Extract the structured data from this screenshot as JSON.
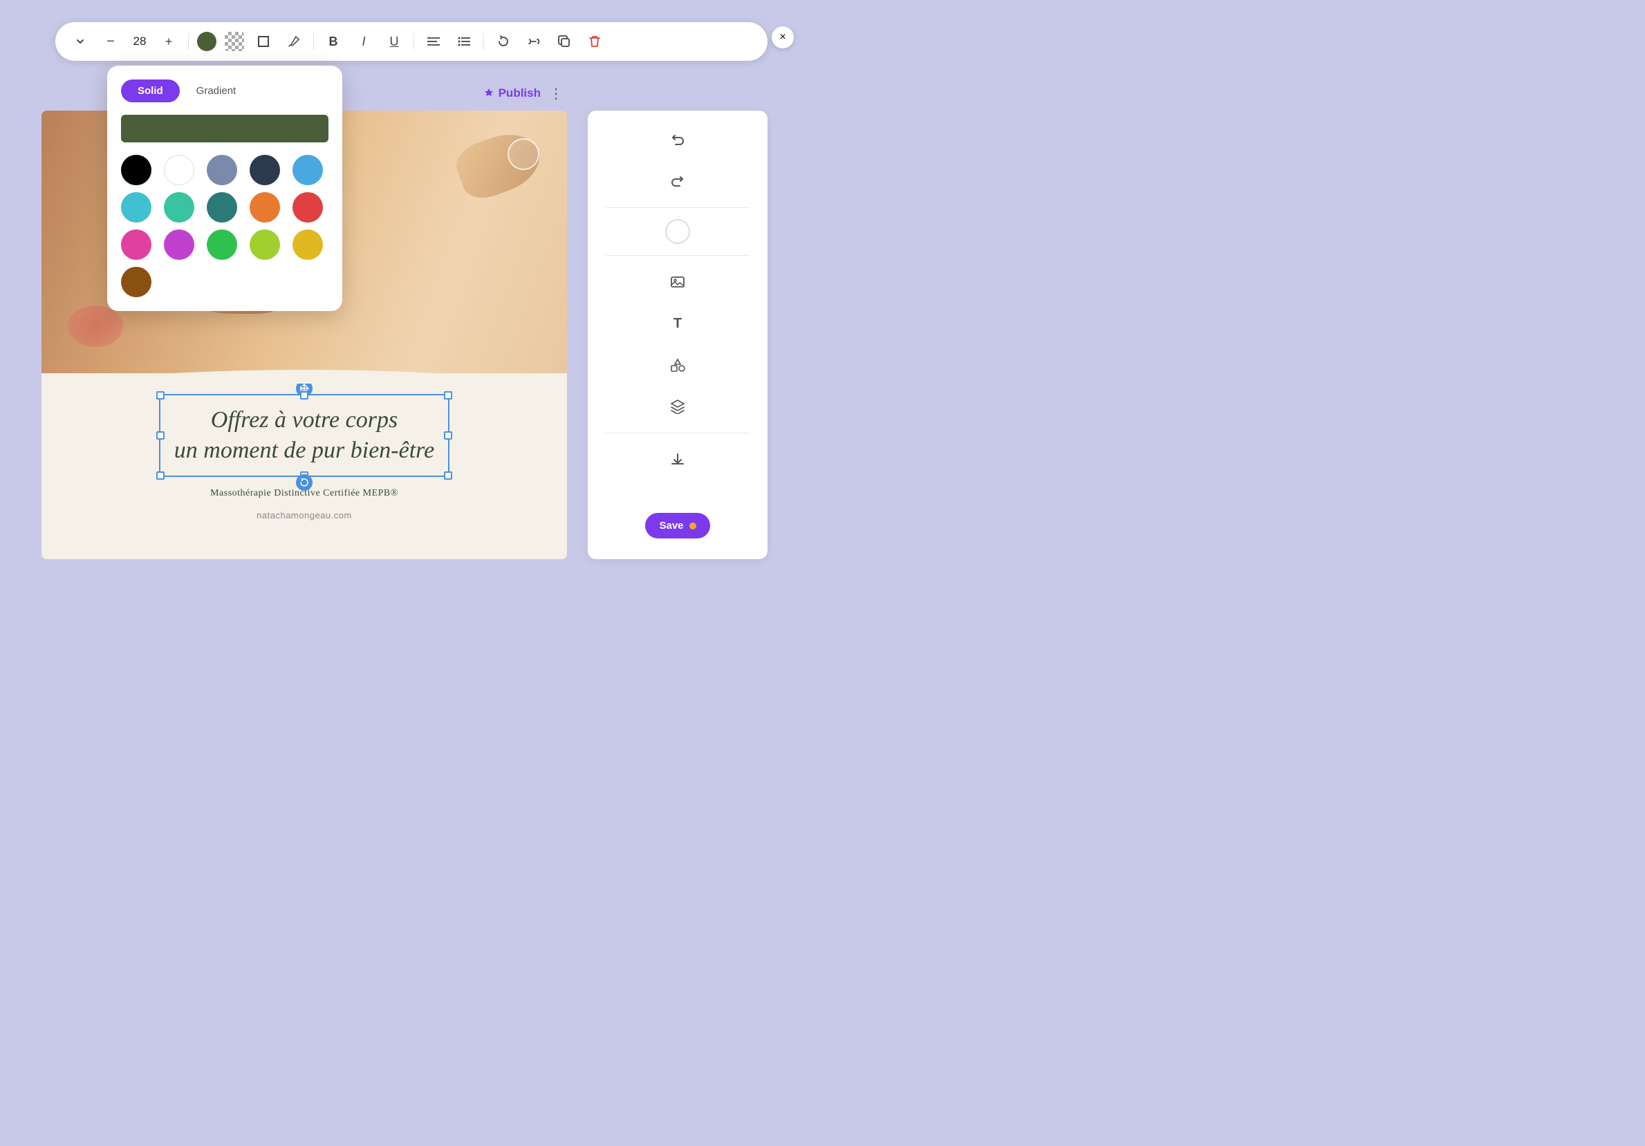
{
  "toolbar": {
    "chevron_down": "›",
    "minus": "–",
    "font_size": "28",
    "plus": "+",
    "bold_label": "B",
    "italic_label": "I",
    "underline_label": "U",
    "align_label": "≡",
    "list_label": "≔",
    "refresh_label": "↺",
    "link_label": "🔗",
    "copy_label": "⎘",
    "delete_label": "🗑"
  },
  "header": {
    "publish_label": "Publish",
    "more_label": "⋮"
  },
  "canvas": {
    "main_heading_line1": "Offrez à votre corps",
    "main_heading_line2": "un moment de pur bien-être",
    "subtitle": "Massothérapie Distinctive Certifiée MEPB®",
    "website": "natachamongeau.com"
  },
  "color_picker": {
    "solid_tab": "Solid",
    "gradient_tab": "Gradient",
    "preview_color": "#4a5e3a",
    "colors": [
      "#000000",
      "#ffffff",
      "#7a8aaa",
      "#2c3a50",
      "#4aa8e0",
      "#40c0d0",
      "#38c4a0",
      "#2a7a78",
      "#e87a30",
      "#e04040",
      "#e040a0",
      "#c040d0",
      "#30c050",
      "#a0d030",
      "#e0b820",
      "#8a5010"
    ]
  },
  "sidebar": {
    "undo_icon": "↩",
    "redo_icon": "↪",
    "image_icon": "🖼",
    "text_icon": "T",
    "shapes_icon": "△◇",
    "layers_icon": "⊞",
    "download_icon": "↓",
    "save_label": "Save"
  },
  "close_icon": "×"
}
